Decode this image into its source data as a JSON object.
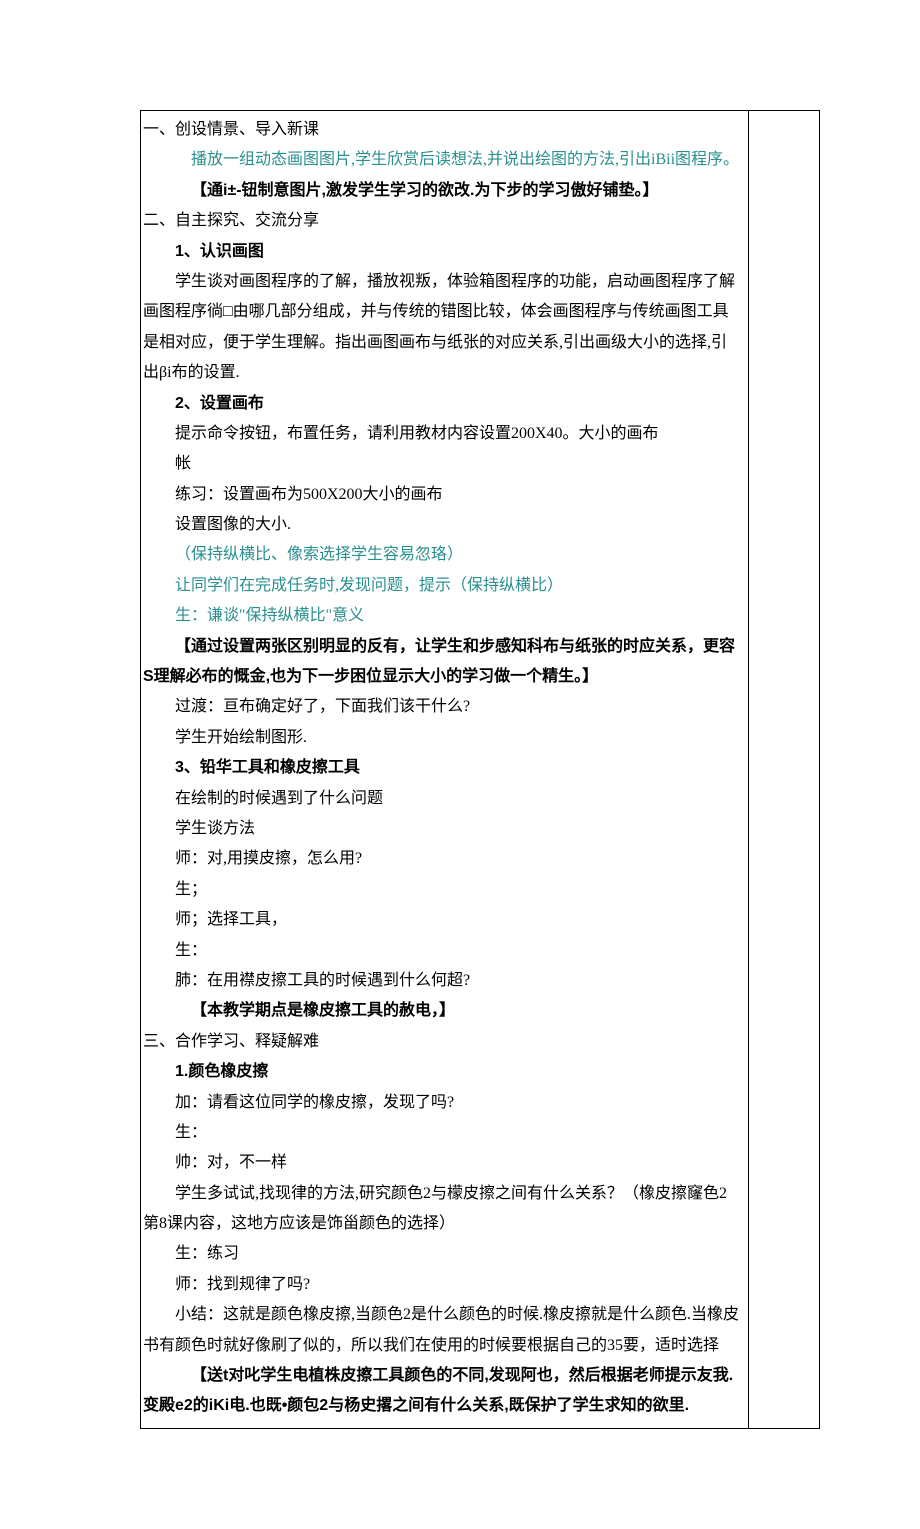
{
  "s1": {
    "title": "一、创设情景、导入新课",
    "p1": "播放一组动态画图图片,学生欣赏后读想法,并说出绘图的方法,引出iBii图程序。",
    "p2": "【通i±-钮制意图片,激发学生学习的欲改.为下步的学习傲好铺垫。】"
  },
  "s2": {
    "title": "二、自主探究、交流分享",
    "i1t": "1、认识画图",
    "i1a": "学生谈对画图程序的了解，播放视叛，体验箱图程序的功能，启动画图程序了解画图程序徜□由哪几部分组成，并与传统的错图比较，体会画图程序与传统画图工具是相对应，便于学生理解。指出画图画布与纸张的对应关系,引出画级大小的选择,引出βi布的设置.",
    "i2t": "2、设置画布",
    "i2a": "提示命令按钮，布置任务，请利用教材内容设置200X40。大小的画布",
    "i2b": "帐",
    "i2c": "练习：设置画布为500X200大小的画布",
    "i2d": "设置图像的大小.",
    "i2e": "（保持纵横比、像索选择学生容易忽珞）",
    "i2f": "让同学们在完成任务时,发现问题，提示（保持纵横比）",
    "i2g": "生：谦谈\"保持纵横比\"意义",
    "i2h": "【通过设置两张区别明显的反有，让学生和步感知科布与纸张的时应关系，更容S理解必布的慨金,也为下一步困位显示大小的学习做一个精生。】",
    "i2i": "过渡：亘布确定好了，下面我们该干什么?",
    "i2j": "学生开始绘制图形.",
    "i3t": "3、铅华工具和橡皮擦工具",
    "i3a": "在绘制的时候遇到了什么问题",
    "i3b": "学生谈方法",
    "i3c": "师：对,用摸皮擦，怎么用?",
    "i3d": "生；",
    "i3e": "师；选择工具，",
    "i3f": "生：",
    "i3g": "肺：在用襟皮擦工具的时候遇到什么何超?",
    "i3h": "【本教学期点是橡皮擦工具的赦电，】"
  },
  "s3": {
    "title": "三、合作学习、释疑解难",
    "i1t": "1.颜色橡皮擦",
    "i1a": "加：请看这位同学的橡皮擦，发现了吗?",
    "i1b": "生：",
    "i1c": "帅：对，不一样",
    "i1d": "学生多试试,找现律的方法,研究颜色2与檬皮擦之间有什么关系？（橡皮擦窿色2第8课内容，这地方应该是饰甾颜色的选择）",
    "i1e": "生：练习",
    "i1f": "师：找到规律了吗?",
    "i1g": "小结：这就是颜色橡皮擦,当颜色2是什么颜色的时候.橡皮擦就是什么颜色.当橡皮书有颜色时就好像刷了似的，所以我们在使用的时候要根据自己的35要，适时选择",
    "i1h": "【送t对叱学生电植株皮擦工具颜色的不同,发现阿也，然后根据老师提示友我.变殿e2的iKi电.也既•颜包2与杨史撂之间有什么关系,既保护了学生求知的欲里."
  }
}
